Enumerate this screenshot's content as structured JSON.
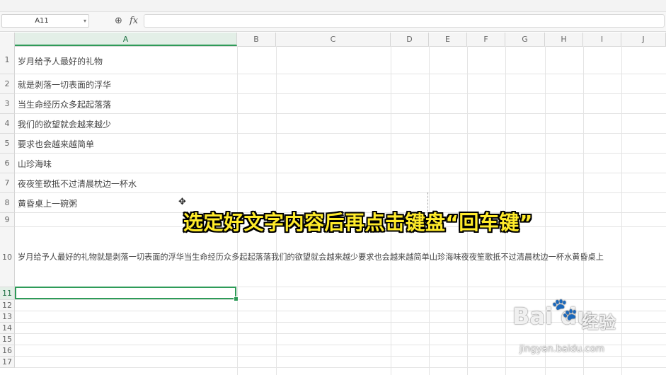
{
  "formula_bar": {
    "name_box": "A11",
    "name_box_arrow": "▾",
    "zoom_icon": "⊕",
    "fx_label": "fx",
    "formula_value": ""
  },
  "columns": [
    "A",
    "B",
    "C",
    "D",
    "E",
    "F",
    "G",
    "H",
    "I",
    "J"
  ],
  "rows": [
    "1",
    "2",
    "3",
    "4",
    "5",
    "6",
    "7",
    "8",
    "9",
    "10",
    "11",
    "12",
    "13",
    "14",
    "15",
    "16",
    "17"
  ],
  "cells": {
    "a1": "岁月给予人最好的礼物",
    "a2": "就是剥落一切表面的浮华",
    "a3": "当生命经历众多起起落落",
    "a4": "我们的欲望就会越来越少",
    "a5": "要求也会越来越简单",
    "a6": "山珍海味",
    "a7": "夜夜笙歌抵不过清晨枕边一杯水",
    "a8": "黄昏桌上一碗粥",
    "a10": "岁月给予人最好的礼物就是剥落一切表面的浮华当生命经历众多起起落落我们的欲望就会越来越少要求也会越来越简单山珍海味夜夜笙歌抵不过清晨枕边一杯水黄昏桌上"
  },
  "selected": {
    "column": "A",
    "row": "11"
  },
  "caption": "选定好文字内容后再点击键盘“回车键”",
  "watermark": {
    "brand": "Bai  du",
    "cn": "经验",
    "url": "jingyan.baidu.com"
  },
  "colors": {
    "selection": "#2e9b58",
    "caption": "#ffeb2a",
    "header_bg": "#f5f5f5"
  }
}
